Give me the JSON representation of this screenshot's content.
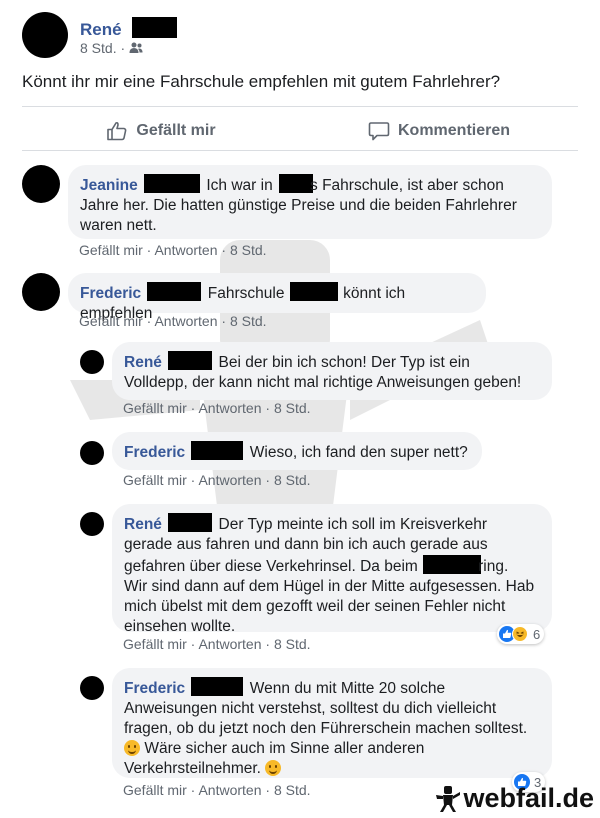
{
  "post": {
    "author": "René",
    "time": "8 Std. ·",
    "text": "Könnt ihr mir eine Fahrschule empfehlen mit gutem Fahrlehrer?",
    "like_label": "Gefällt mir",
    "comment_label": "Kommentieren"
  },
  "comments": [
    {
      "author": "Jeanine",
      "line1_a": "Ich war in",
      "line1_b": "s Fahrschule, ist aber schon",
      "rest": "Jahre her. Die hatten günstige Preise und die beiden Fahrlehrer waren nett.",
      "like": "Gefällt mir",
      "reply": "Antworten",
      "time": "8 Std."
    },
    {
      "author": "Frederic",
      "text_a": "Fahrschule",
      "text_b": "könnt ich empfehlen",
      "like": "Gefällt mir",
      "reply": "Antworten",
      "time": "8 Std."
    }
  ],
  "replies": [
    {
      "author": "René",
      "line1": "Bei der bin ich schon! Der Typ ist ein",
      "rest": "Volldepp, der kann nicht mal richtige Anweisungen geben!",
      "like": "Gefällt mir",
      "reply": "Antworten",
      "time": "8 Std."
    },
    {
      "author": "Frederic",
      "text": "Wieso, ich fand den super nett?",
      "like": "Gefällt mir",
      "reply": "Antworten",
      "time": "8 Std."
    },
    {
      "author": "René",
      "line1": "Der Typ meinte ich soll im Kreisverkehr",
      "line2": "gerade aus fahren und dann bin ich auch gerade aus",
      "line3_a": "gefahren über diese Verkehrinsel. Da beim",
      "line3_b": "ring.",
      "rest": "Wir sind dann auf dem Hügel in der Mitte aufgesessen. Hab mich übelst mit dem gezofft weil der seinen Fehler nicht einsehen wollte.",
      "reactions": "6",
      "like": "Gefällt mir",
      "reply": "Antworten",
      "time": "8 Std."
    },
    {
      "author": "Frederic",
      "line1": "Wenn du mit Mitte 20 solche",
      "line2": "Anweisungen nicht verstehst, solltest du dich vielleicht",
      "line3": "fragen, ob du jetzt noch den Führerschein machen solltest.",
      "line4": "Wäre sicher auch im Sinne aller anderen",
      "line5": "Verkehrsteilnehmer.",
      "reactions": "3",
      "like": "Gefällt mir",
      "reply": "Antworten",
      "time": "8 Std."
    }
  ],
  "brand": "webfail.de"
}
